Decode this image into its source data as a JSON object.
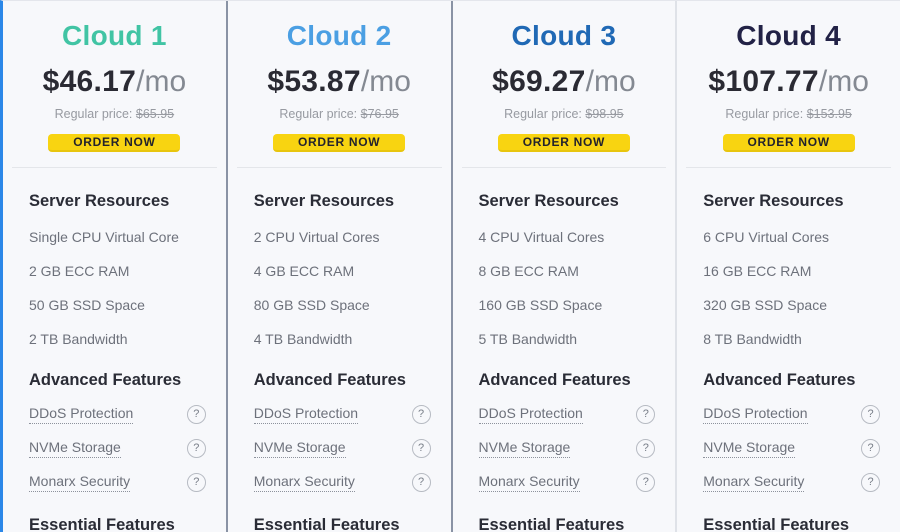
{
  "help_glyph": "?",
  "colors": {
    "accent_left_border": "#2b87e8",
    "button_bg": "#f8d411",
    "button_text": "#23232d",
    "price_dark": "#2a2a33",
    "divider_dark": "#8a93a5",
    "divider_light": "#dfe2e8"
  },
  "plans": [
    {
      "name": "Cloud 1",
      "color": "#41c4a4",
      "price": "$46.17",
      "per": "/mo",
      "regular_price_label": "Regular price:",
      "regular_price": "$65.95",
      "order_label": "ORDER NOW",
      "resources_heading": "Server Resources",
      "resources": [
        "Single CPU Virtual Core",
        "2 GB ECC RAM",
        "50 GB SSD Space",
        "2 TB Bandwidth"
      ],
      "advanced_heading": "Advanced Features",
      "advanced": [
        "DDoS Protection",
        "NVMe Storage",
        "Monarx Security"
      ],
      "essential_heading": "Essential Features"
    },
    {
      "name": "Cloud 2",
      "color": "#4b9fe3",
      "price": "$53.87",
      "per": "/mo",
      "regular_price_label": "Regular price:",
      "regular_price": "$76.95",
      "order_label": "ORDER NOW",
      "resources_heading": "Server Resources",
      "resources": [
        "2 CPU Virtual Cores",
        "4 GB ECC RAM",
        "80 GB SSD Space",
        "4 TB Bandwidth"
      ],
      "advanced_heading": "Advanced Features",
      "advanced": [
        "DDoS Protection",
        "NVMe Storage",
        "Monarx Security"
      ],
      "essential_heading": "Essential Features"
    },
    {
      "name": "Cloud 3",
      "color": "#2069b5",
      "price": "$69.27",
      "per": "/mo",
      "regular_price_label": "Regular price:",
      "regular_price": "$98.95",
      "order_label": "ORDER NOW",
      "resources_heading": "Server Resources",
      "resources": [
        "4 CPU Virtual Cores",
        "8 GB ECC RAM",
        "160 GB SSD Space",
        "5 TB Bandwidth"
      ],
      "advanced_heading": "Advanced Features",
      "advanced": [
        "DDoS Protection",
        "NVMe Storage",
        "Monarx Security"
      ],
      "essential_heading": "Essential Features"
    },
    {
      "name": "Cloud 4",
      "color": "#222246",
      "price": "$107.77",
      "per": "/mo",
      "regular_price_label": "Regular price:",
      "regular_price": "$153.95",
      "order_label": "ORDER NOW",
      "resources_heading": "Server Resources",
      "resources": [
        "6 CPU Virtual Cores",
        "16 GB ECC RAM",
        "320 GB SSD Space",
        "8 TB Bandwidth"
      ],
      "advanced_heading": "Advanced Features",
      "advanced": [
        "DDoS Protection",
        "NVMe Storage",
        "Monarx Security"
      ],
      "essential_heading": "Essential Features"
    }
  ]
}
